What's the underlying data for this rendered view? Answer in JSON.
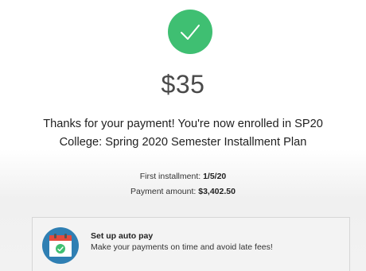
{
  "confirmation": {
    "status_icon": "checkmark-icon",
    "amount": "$35",
    "thanks_line1": "Thanks for your payment! You're now enrolled in SP20",
    "thanks_line2": "College: Spring 2020 Semester Installment Plan"
  },
  "details": {
    "first_installment_label": "First installment:",
    "first_installment_value": "1/5/20",
    "payment_amount_label": "Payment amount:",
    "payment_amount_value": "$3,402.50"
  },
  "autopay": {
    "icon": "calendar-check-icon",
    "title": "Set up auto pay",
    "subtitle": "Make your payments on time and avoid late fees!"
  },
  "colors": {
    "success_green": "#3fbf72",
    "icon_blue": "#2f7fb3",
    "calendar_red": "#e44b3c"
  }
}
